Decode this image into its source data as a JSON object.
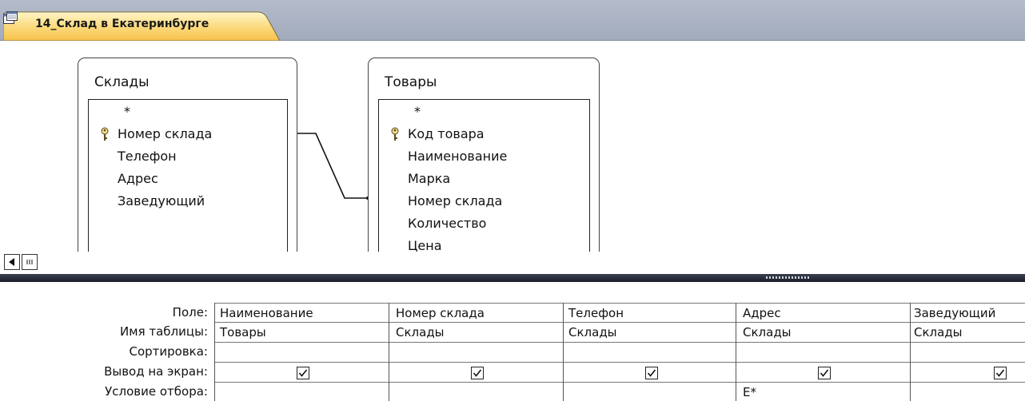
{
  "tab": {
    "title": "14_Склад в Екатеринбурге",
    "icon": "query-icon"
  },
  "tables": [
    {
      "title": "Склады",
      "fields": [
        "*",
        "Номер склада",
        "Телефон",
        "Адрес",
        "Заведующий"
      ],
      "key_field": "Номер склада"
    },
    {
      "title": "Товары",
      "fields": [
        "*",
        "Код товара",
        "Наименование",
        "Марка",
        "Номер склада",
        "Количество",
        "Цена"
      ],
      "key_field": "Код товара"
    }
  ],
  "relationship": {
    "from": "Склады.Номер склада",
    "to": "Товары.Номер склада"
  },
  "grid": {
    "row_labels": {
      "field": "Поле:",
      "table": "Имя таблицы:",
      "sort": "Сортировка:",
      "show": "Вывод на экран:",
      "criteria": "Условие отбора:"
    },
    "columns": [
      {
        "field": "Наименование",
        "table": "Товары",
        "sort": "",
        "show": true,
        "criteria": ""
      },
      {
        "field": "Номер склада",
        "table": "Склады",
        "sort": "",
        "show": true,
        "criteria": ""
      },
      {
        "field": "Телефон",
        "table": "Склады",
        "sort": "",
        "show": true,
        "criteria": ""
      },
      {
        "field": "Адрес",
        "table": "Склады",
        "sort": "",
        "show": true,
        "criteria": "Е*"
      },
      {
        "field": "Заведующий",
        "table": "Склады",
        "sort": "",
        "show": true,
        "criteria": ""
      }
    ]
  },
  "scroll": {
    "left_icon": "arrow-left-icon",
    "thumb_icon": "scroll-thumb-icon"
  }
}
